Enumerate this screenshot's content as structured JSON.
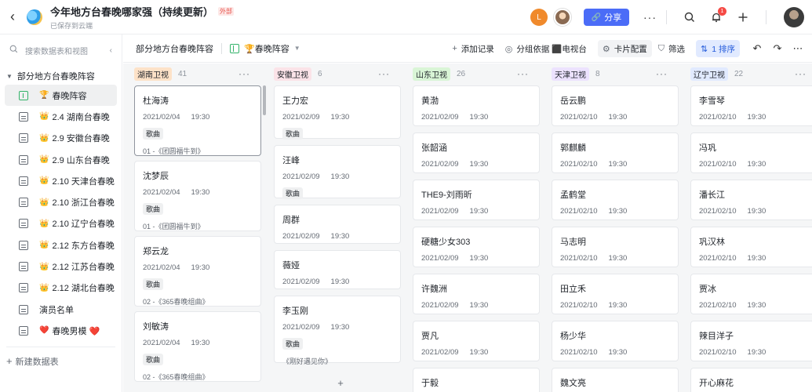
{
  "header": {
    "title": "今年地方台春晚哪家强（持续更新）",
    "tag": "外部",
    "subtitle": "已保存到云端",
    "share_label": "分享",
    "notification_count": "1",
    "avatar_letter": "L"
  },
  "sidebar": {
    "search_placeholder": "搜索数据表和视图",
    "group_title": "部分地方台春晚阵容",
    "items": [
      {
        "emoji": "🏆",
        "label": "春晚阵容"
      },
      {
        "emoji": "👑",
        "label": "2.4 湖南台春晚"
      },
      {
        "emoji": "👑",
        "label": "2.9 安徽台春晚"
      },
      {
        "emoji": "👑",
        "label": "2.9 山东台春晚"
      },
      {
        "emoji": "👑",
        "label": "2.10 天津台春晚"
      },
      {
        "emoji": "👑",
        "label": "2.10 浙江台春晚"
      },
      {
        "emoji": "👑",
        "label": "2.10 辽宁台春晚"
      },
      {
        "emoji": "👑",
        "label": "2.12 东方台春晚"
      },
      {
        "emoji": "👑",
        "label": "2.12 江苏台春晚"
      },
      {
        "emoji": "👑",
        "label": "2.12 湖北台春晚"
      },
      {
        "emoji": "",
        "label": "演员名单"
      },
      {
        "emoji": "❤️",
        "label": "春晚男模 ❤️"
      }
    ],
    "new_table": "新建数据表"
  },
  "toolbar": {
    "table_name": "部分地方台春晚阵容",
    "view_name": "🏆春晚阵容",
    "add_record": "添加记录",
    "group_by": "分组依据 ⬛电视台",
    "card_config": "卡片配置",
    "filter": "筛选",
    "sort": "1 排序"
  },
  "board": {
    "columns": [
      {
        "name": "湖南卫视",
        "count": "41",
        "color": "#fde2c8",
        "cards": [
          {
            "name": "杜海涛",
            "date": "2021/02/04",
            "time": "19:30",
            "type": "歌曲",
            "song": "01 -《团圆福牛到》"
          },
          {
            "name": "沈梦辰",
            "date": "2021/02/04",
            "time": "19:30",
            "type": "歌曲",
            "song": "01 -《团圆福牛到》"
          },
          {
            "name": "郑云龙",
            "date": "2021/02/04",
            "time": "19:30",
            "type": "歌曲",
            "song": "02 -《365春晚组曲》"
          },
          {
            "name": "刘敏涛",
            "date": "2021/02/04",
            "time": "19:30",
            "type": "歌曲",
            "song": "02 -《365春晚组曲》"
          }
        ]
      },
      {
        "name": "安徽卫视",
        "count": "6",
        "color": "#fbe3e8",
        "cards": [
          {
            "name": "王力宏",
            "date": "2021/02/09",
            "time": "19:30",
            "type": "歌曲",
            "song": ""
          },
          {
            "name": "汪峰",
            "date": "2021/02/09",
            "time": "19:30",
            "type": "歌曲",
            "song": ""
          },
          {
            "name": "周群",
            "date": "2021/02/09",
            "time": "19:30",
            "type": "",
            "song": ""
          },
          {
            "name": "薇娅",
            "date": "2021/02/09",
            "time": "19:30",
            "type": "",
            "song": ""
          },
          {
            "name": "李玉刚",
            "date": "2021/02/09",
            "time": "19:30",
            "type": "歌曲",
            "song": "《刚好遇见你》"
          }
        ]
      },
      {
        "name": "山东卫视",
        "count": "26",
        "color": "#d9f5d6",
        "cards": [
          {
            "name": "黄渤",
            "date": "2021/02/09",
            "time": "19:30"
          },
          {
            "name": "张韶涵",
            "date": "2021/02/09",
            "time": "19:30"
          },
          {
            "name": "THE9-刘雨昕",
            "date": "2021/02/09",
            "time": "19:30"
          },
          {
            "name": "硬糖少女303",
            "date": "2021/02/09",
            "time": "19:30"
          },
          {
            "name": "许魏洲",
            "date": "2021/02/09",
            "time": "19:30"
          },
          {
            "name": "贾凡",
            "date": "2021/02/09",
            "time": "19:30"
          },
          {
            "name": "于毅",
            "date": "",
            "time": ""
          }
        ]
      },
      {
        "name": "天津卫视",
        "count": "8",
        "color": "#ece2fe",
        "cards": [
          {
            "name": "岳云鹏",
            "date": "2021/02/10",
            "time": "19:30"
          },
          {
            "name": "郭麒麟",
            "date": "2021/02/10",
            "time": "19:30"
          },
          {
            "name": "孟鹤堂",
            "date": "2021/02/10",
            "time": "19:30"
          },
          {
            "name": "马志明",
            "date": "2021/02/10",
            "time": "19:30"
          },
          {
            "name": "田立禾",
            "date": "2021/02/10",
            "time": "19:30"
          },
          {
            "name": "杨少华",
            "date": "2021/02/10",
            "time": "19:30"
          },
          {
            "name": "魏文亮",
            "date": "",
            "time": ""
          }
        ]
      },
      {
        "name": "辽宁卫视",
        "count": "22",
        "color": "#e1eaff",
        "cards": [
          {
            "name": "李雪琴",
            "date": "2021/02/10",
            "time": "19:30"
          },
          {
            "name": "冯巩",
            "date": "2021/02/10",
            "time": "19:30"
          },
          {
            "name": "潘长江",
            "date": "2021/02/10",
            "time": "19:30"
          },
          {
            "name": "巩汉林",
            "date": "2021/02/10",
            "time": "19:30"
          },
          {
            "name": "贾冰",
            "date": "2021/02/10",
            "time": "19:30"
          },
          {
            "name": "辣目洋子",
            "date": "2021/02/10",
            "time": "19:30"
          },
          {
            "name": "开心麻花",
            "date": "",
            "time": ""
          }
        ]
      }
    ]
  }
}
